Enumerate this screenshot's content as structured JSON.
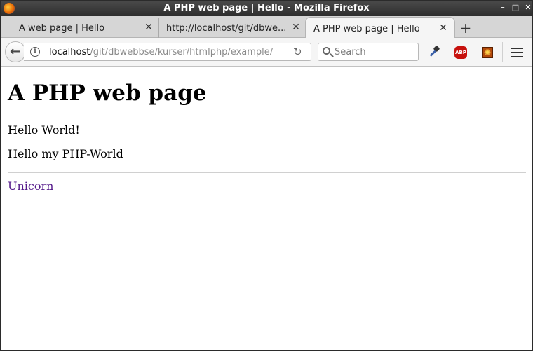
{
  "window": {
    "title": "A PHP web page | Hello - Mozilla Firefox",
    "controls": {
      "minimize": "–",
      "maximize": "□",
      "close": "✕"
    }
  },
  "tabs": [
    {
      "label": "A web page | Hello",
      "active": false
    },
    {
      "label": "http://localhost/git/dbwe...",
      "active": false
    },
    {
      "label": "A PHP web page | Hello",
      "active": true
    }
  ],
  "tab_close_glyph": "✕",
  "new_tab_glyph": "+",
  "navbar": {
    "back_glyph": "←",
    "url_host": "localhost",
    "url_path": "/git/dbwebbse/kurser/htmlphp/example/",
    "reload_glyph": "↻",
    "search_placeholder": "Search",
    "icons": [
      "back-icon",
      "info-icon",
      "reload-icon",
      "search-icon",
      "eyedropper-icon",
      "adblock-plus-icon",
      "extension-icon",
      "hamburger-menu-icon"
    ],
    "abp_text": "ABP",
    "ext_glyph": "✺"
  },
  "page": {
    "heading": "A PHP web page",
    "paragraphs": [
      "Hello World!",
      "Hello my PHP-World"
    ],
    "link_text": "Unicorn"
  },
  "colors": {
    "titlebar": "#3a3a3a",
    "tabstrip": "#d6d6d6",
    "toolbar": "#f5f5f5",
    "visited_link": "#551a8b",
    "abp_red": "#c7110d"
  }
}
